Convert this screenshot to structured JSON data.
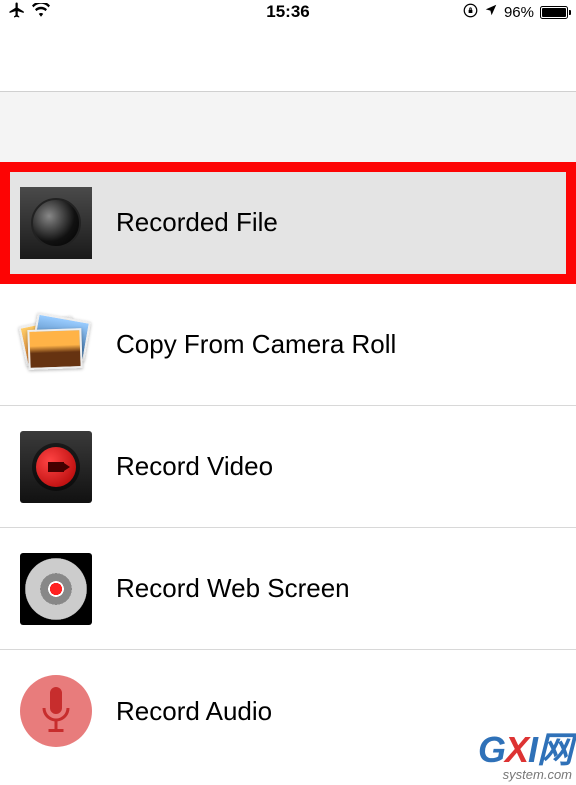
{
  "status": {
    "time": "15:36",
    "battery_pct": "96%"
  },
  "menu": {
    "items": [
      {
        "label": "Recorded File"
      },
      {
        "label": "Copy From Camera Roll"
      },
      {
        "label": "Record Video"
      },
      {
        "label": "Record Web Screen"
      },
      {
        "label": "Record Audio"
      }
    ]
  },
  "watermark": {
    "brand_g": "G",
    "brand_x": "X",
    "brand_i": "I",
    "brand_net": "网",
    "sub": "system.com"
  }
}
